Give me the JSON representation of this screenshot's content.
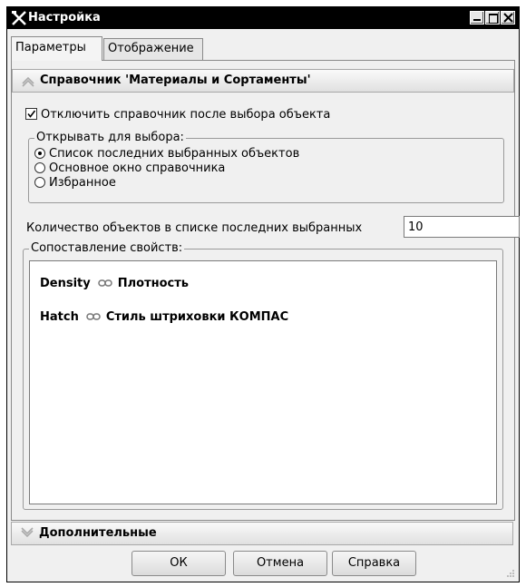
{
  "window": {
    "title": "Настройка"
  },
  "tabs": [
    {
      "label": "Параметры",
      "active": true
    },
    {
      "label": "Отображение",
      "active": false
    }
  ],
  "section_main": {
    "title": "Справочник 'Материалы и Сортаменты'",
    "expanded": true
  },
  "disable_after_select": {
    "label": "Отключить справочник после выбора объекта",
    "checked": true
  },
  "open_for_select": {
    "legend": "Открывать для выбора:",
    "options": [
      {
        "label": "Список последних выбранных объектов",
        "selected": true
      },
      {
        "label": "Основное окно справочника",
        "selected": false
      },
      {
        "label": "Избранное",
        "selected": false
      }
    ]
  },
  "recent_count": {
    "label": "Количество объектов в списке последних выбранных",
    "value": "10"
  },
  "mapping": {
    "legend": "Сопоставление свойств:",
    "rows": [
      {
        "source": "Density",
        "target": "Плотность"
      },
      {
        "source": "Hatch",
        "target": "Стиль штриховки КОМПАС"
      }
    ]
  },
  "section_extra": {
    "title": "Дополнительные",
    "expanded": false
  },
  "buttons": {
    "ok": "ОК",
    "cancel": "Отмена",
    "help": "Справка"
  }
}
